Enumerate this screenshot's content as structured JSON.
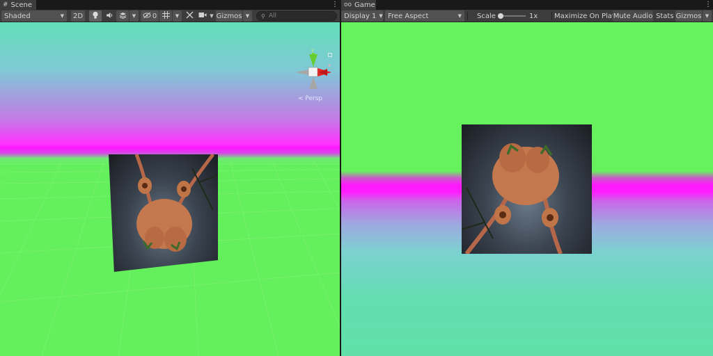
{
  "scene": {
    "tab_label": "Scene",
    "tab_icon": "#",
    "menu_glyph": "⋮",
    "toolbar": {
      "draw_mode": "Shaded",
      "mode_2d": "2D",
      "hidden_count": "0",
      "gizmos_label": "Gizmos",
      "search_placeholder": "All"
    },
    "gizmo": {
      "y_label": "y",
      "x_label": "x",
      "projection_label": "< Persp"
    }
  },
  "game": {
    "tab_label": "Game",
    "tab_icon": "oo",
    "menu_glyph": "⋮",
    "toolbar": {
      "display": "Display 1",
      "aspect": "Free Aspect",
      "scale_label": "Scale",
      "scale_value": "1x",
      "maximize_label": "Maximize On Play",
      "mute_label": "Mute Audio",
      "stats_label": "Stats",
      "gizmos_label": "Gizmos"
    }
  },
  "colors": {
    "ground_green": "#64ef5c",
    "sky_teal": "#62dfb8",
    "horizon_magenta": "#ff18ff",
    "toolbar_bg": "#3c3c3c"
  }
}
